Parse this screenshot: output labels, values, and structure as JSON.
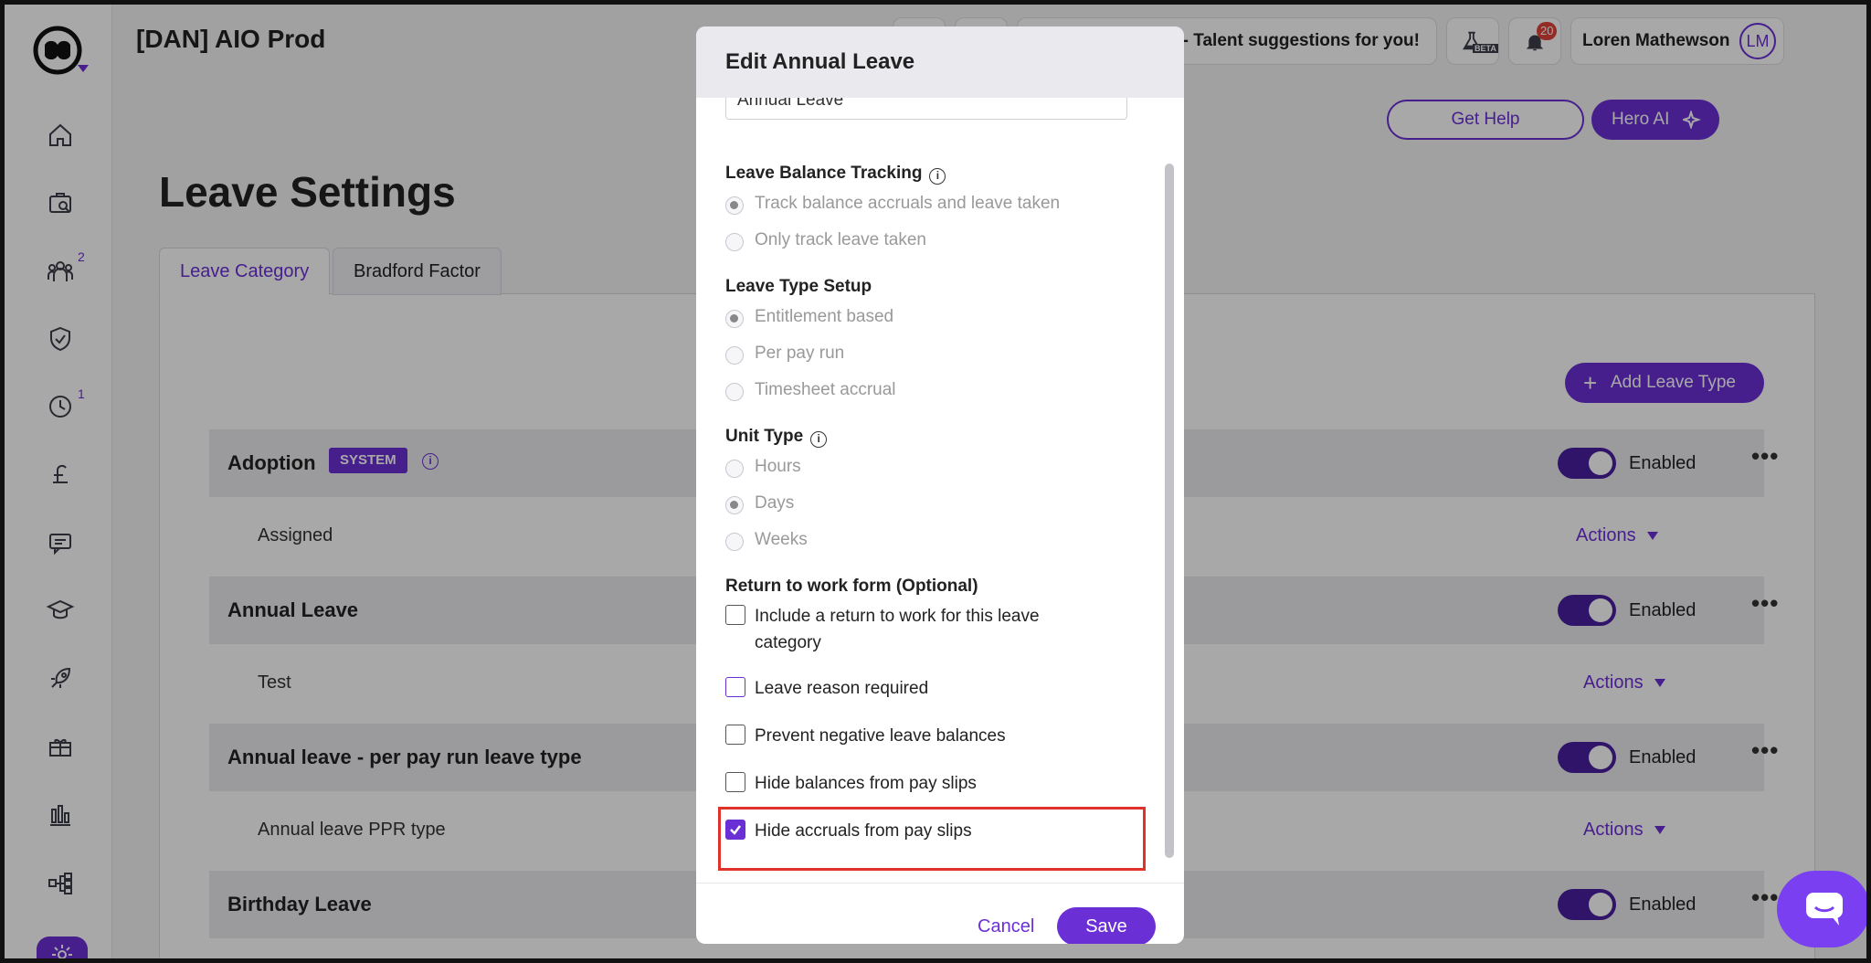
{
  "app": {
    "title": "[DAN] AIO Prod"
  },
  "topbar": {
    "talent_text": "- Talent suggestions for you!",
    "beta_label": "BETA",
    "notification_count": "20",
    "user_name": "Loren Mathewson",
    "user_initials": "LM"
  },
  "header_actions": {
    "get_help": "Get Help",
    "hero_ai": "Hero AI"
  },
  "sidebar": {
    "badges": {
      "people": "2",
      "clock": "1"
    }
  },
  "page": {
    "title": "Leave Settings",
    "tabs": [
      {
        "label": "Leave Category",
        "active": true
      },
      {
        "label": "Bradford Factor",
        "active": false
      }
    ],
    "add_button": "Add Leave Type",
    "enabled_label": "Enabled",
    "actions_label": "Actions",
    "system_badge": "SYSTEM",
    "leave_types": [
      {
        "name": "Adoption",
        "sub": "Assigned"
      },
      {
        "name": "Annual Leave",
        "sub": "Test"
      },
      {
        "name": "Annual leave - per pay run leave type",
        "sub": "Annual leave PPR type"
      },
      {
        "name": "Birthday Leave"
      }
    ]
  },
  "modal": {
    "title": "Edit Annual Leave",
    "name_value": "Annual Leave",
    "balance_tracking": {
      "label": "Leave Balance Tracking",
      "options": [
        "Track balance accruals and leave taken",
        "Only track leave taken"
      ],
      "selected": 0
    },
    "type_setup": {
      "label": "Leave Type Setup",
      "options": [
        "Entitlement based",
        "Per pay run",
        "Timesheet accrual"
      ],
      "selected": 0
    },
    "unit_type": {
      "label": "Unit Type",
      "options": [
        "Hours",
        "Days",
        "Weeks"
      ],
      "selected": 1
    },
    "return_form": {
      "label": "Return to work form (Optional)",
      "checkboxes": [
        {
          "label": "Include a return to work for this leave category",
          "checked": false
        },
        {
          "label": "Leave reason required",
          "checked": false
        },
        {
          "label": "Prevent negative leave balances",
          "checked": false
        },
        {
          "label": "Hide balances from pay slips",
          "checked": false
        },
        {
          "label": "Hide accruals from pay slips",
          "checked": true
        }
      ]
    },
    "cancel": "Cancel",
    "save": "Save"
  },
  "colors": {
    "accent": "#6b2fd6",
    "highlight": "#e0322a",
    "toggle": "#4a1fa0"
  }
}
